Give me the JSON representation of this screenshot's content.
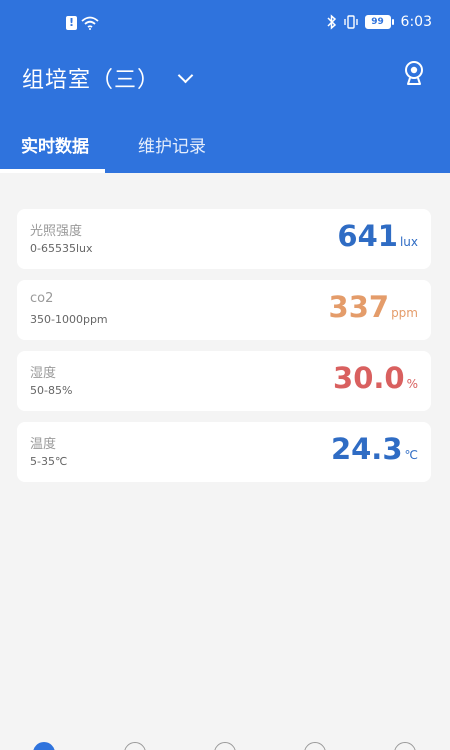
{
  "status_bar": {
    "time": "6:03",
    "battery": "99"
  },
  "header": {
    "title": "组培室（三）",
    "icons": {
      "dropdown": "chevron-down-icon",
      "camera": "camera-icon"
    }
  },
  "tabs": [
    {
      "label": "实时数据",
      "active": true
    },
    {
      "label": "维护记录",
      "active": false
    }
  ],
  "sensors": [
    {
      "name": "光照强度",
      "range": "0-65535lux",
      "value": "641",
      "unit": "lux",
      "color": "#2f6cc4"
    },
    {
      "name": "co2",
      "range": "350-1000ppm",
      "value": "337",
      "unit": "ppm",
      "color": "#e49c6a"
    },
    {
      "name": "湿度",
      "range": "50-85%",
      "value": "30.0",
      "unit": "%",
      "color": "#d9605f"
    },
    {
      "name": "温度",
      "range": "5-35℃",
      "value": "24.3",
      "unit": "℃",
      "color": "#2f6cc4"
    }
  ],
  "colors": {
    "primary": "#2f73dd",
    "background": "#f4f4f4"
  }
}
